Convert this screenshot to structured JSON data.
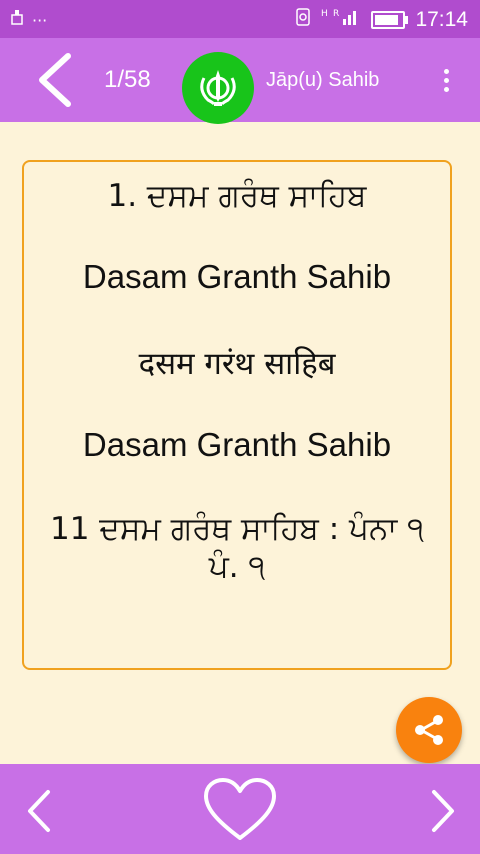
{
  "status_bar": {
    "time": "17:14",
    "notification_dots": "···",
    "network": "H R"
  },
  "app_bar": {
    "page_counter": "1/58",
    "title": "Jāp(u) Sahib",
    "back_icon": "chevron-left-icon",
    "logo_icon": "khanda-icon",
    "menu_icon": "more-vertical-icon"
  },
  "content": {
    "line1": "1. ਦਸਮ ਗਰੰਥ ਸਾਹਿਬ",
    "line2": "Dasam Granth Sahib",
    "line3": "दसम गरंथ साहिब",
    "line4": "Dasam Granth Sahib",
    "line5": "11 ਦਸਮ ਗਰੰਥ ਸਾਹਿਬ : ਪੰਨਾ ੧ ਪੰ. ੧"
  },
  "fab": {
    "icon": "share-icon"
  },
  "bottom_bar": {
    "prev_icon": "chevron-left-icon",
    "favorite_icon": "heart-outline-icon",
    "next_icon": "chevron-right-icon"
  },
  "colors": {
    "status_bar": "#b04cce",
    "app_bar": "#c870e6",
    "background": "#fdf3d9",
    "card_border": "#f0a11e",
    "logo_bg": "#18c41a",
    "fab": "#f9820e"
  }
}
